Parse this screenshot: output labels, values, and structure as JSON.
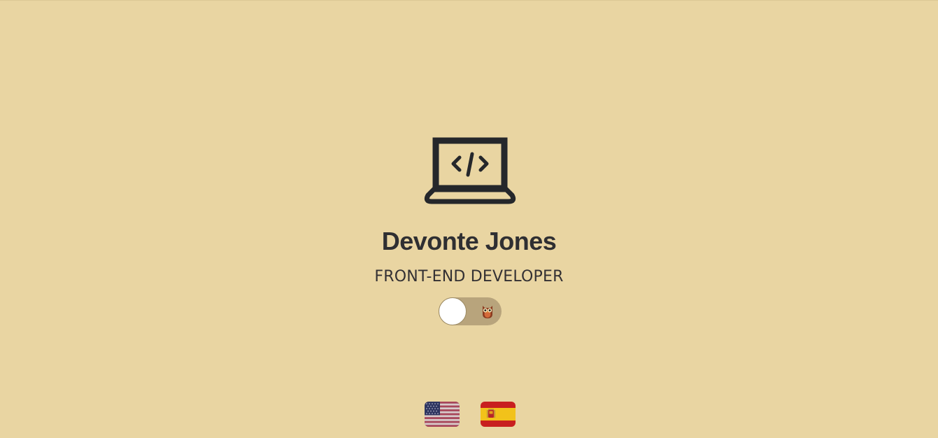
{
  "profile": {
    "name": "Devonte Jones",
    "title": "FRONT-END DEVELOPER"
  },
  "icons": {
    "hero": "laptop-code-icon",
    "toggle": "owl-icon"
  },
  "theme_toggle": {
    "state": "off"
  },
  "languages": [
    {
      "code": "en",
      "icon": "us-flag-icon"
    },
    {
      "code": "es",
      "icon": "spain-flag-icon"
    }
  ],
  "colors": {
    "background": "#e9d5a2",
    "text": "#2f2f32",
    "toggle_track": "#b8a47c",
    "toggle_knob": "#ffffff"
  }
}
